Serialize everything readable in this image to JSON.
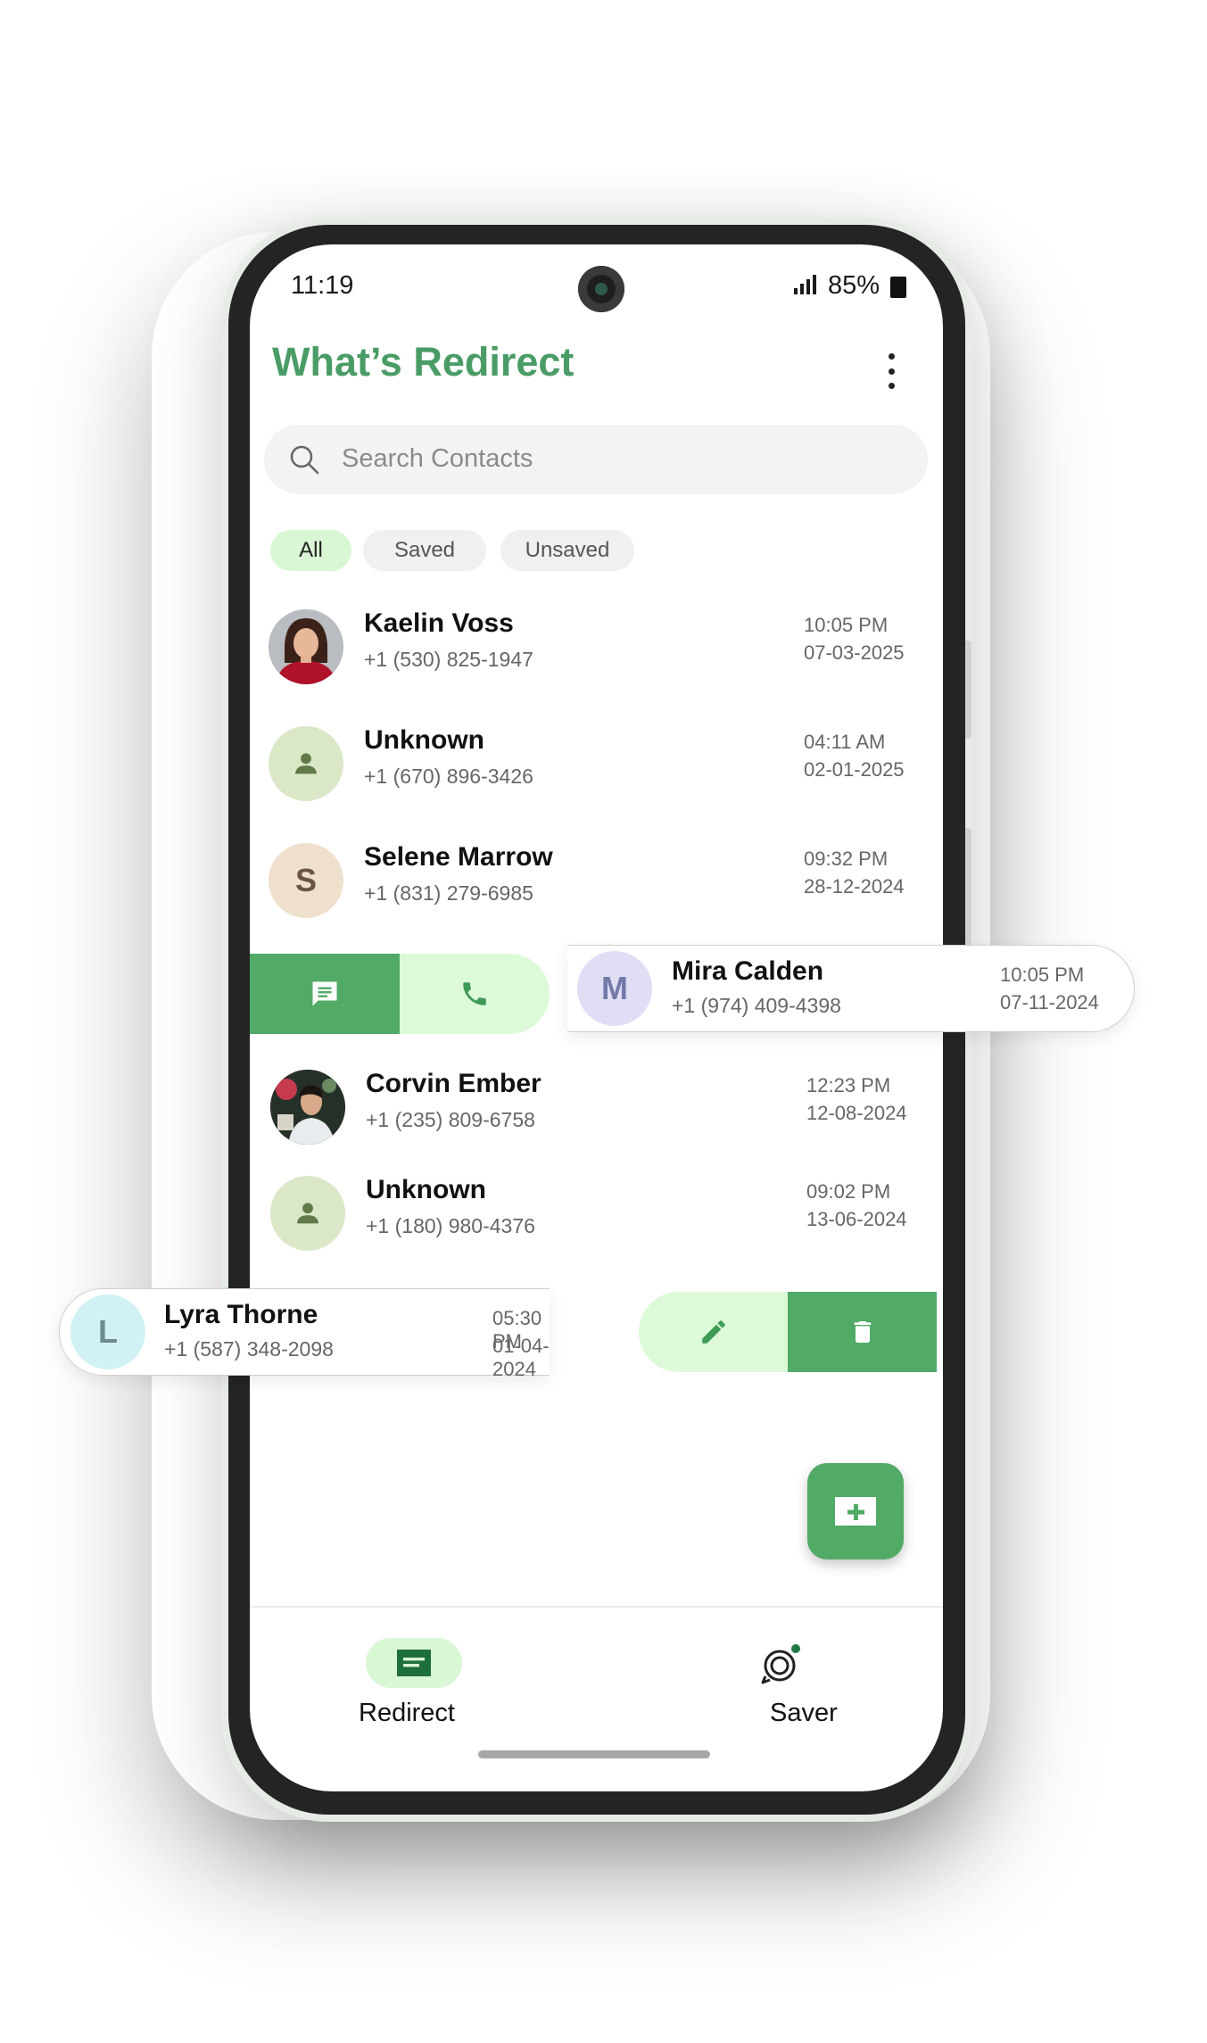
{
  "status_bar": {
    "time": "11:19",
    "battery": "85%"
  },
  "app": {
    "title": "What’s Redirect"
  },
  "search": {
    "placeholder": "Search Contacts"
  },
  "filters": [
    {
      "label": "All",
      "active": true
    },
    {
      "label": "Saved",
      "active": false
    },
    {
      "label": "Unsaved",
      "active": false
    }
  ],
  "contacts": [
    {
      "name": "Kaelin Voss",
      "phone": "+1 (530) 825-1947",
      "time": "10:05 PM",
      "date": "07-03-2025",
      "avatar": "photo"
    },
    {
      "name": "Unknown",
      "phone": "+1 (670) 896-3426",
      "time": "04:11 AM",
      "date": "02-01-2025",
      "avatar": "person-icon"
    },
    {
      "name": "Selene Marrow",
      "phone": "+1 (831) 279-6985",
      "time": "09:32 PM",
      "date": "28-12-2024",
      "avatar": "S"
    },
    {
      "name": "Mira Calden",
      "phone": "+1 (974) 409-4398",
      "time": "10:05 PM",
      "date": "07-11-2024",
      "avatar": "M"
    },
    {
      "name": "Corvin Ember",
      "phone": "+1 (235) 809-6758",
      "time": "12:23 PM",
      "date": "12-08-2024",
      "avatar": "photo"
    },
    {
      "name": "Unknown",
      "phone": "+1 (180) 980-4376",
      "time": "09:02 PM",
      "date": "13-06-2024",
      "avatar": "person-icon"
    },
    {
      "name": "Lyra Thorne",
      "phone": "+1 (587) 348-2098",
      "time": "05:30 PM",
      "date": "01-04-2024",
      "avatar": "L"
    }
  ],
  "swipe_actions": {
    "left": [
      "message-icon",
      "phone-call-icon"
    ],
    "right": [
      "edit-icon",
      "delete-icon"
    ]
  },
  "nav": {
    "items": [
      {
        "label": "Redirect",
        "icon": "redirect-icon",
        "active": true
      },
      {
        "label": "Saver",
        "icon": "saver-icon",
        "active": false
      }
    ]
  },
  "colors": {
    "accent": "#51aa66",
    "title_green": "#4a9c66",
    "light_green": "#ddfad8"
  }
}
